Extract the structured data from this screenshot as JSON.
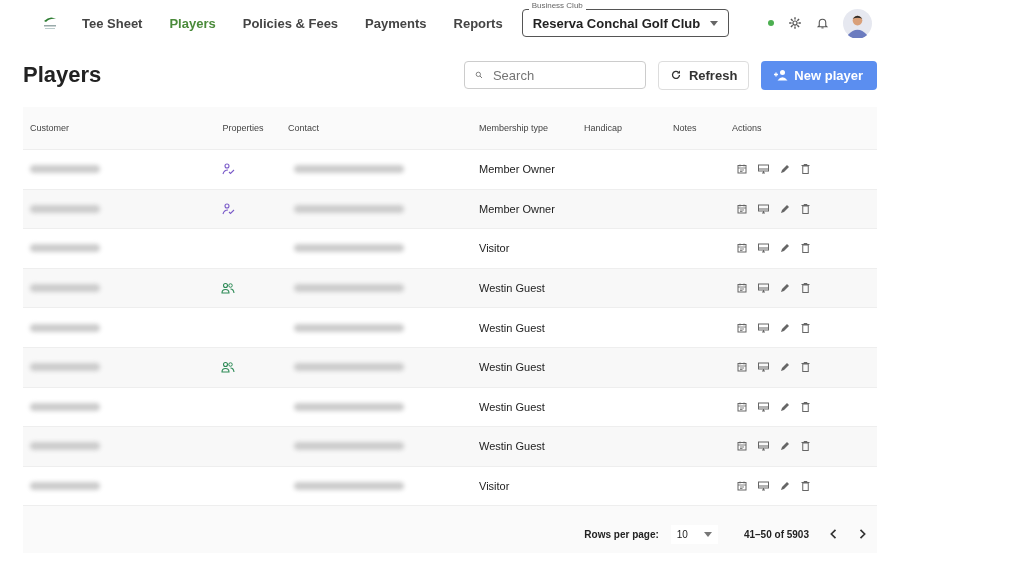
{
  "nav": {
    "items": [
      {
        "label": "Tee Sheet",
        "selected": false
      },
      {
        "label": "Players",
        "selected": true
      },
      {
        "label": "Policies & Fees",
        "selected": false
      },
      {
        "label": "Payments",
        "selected": false
      },
      {
        "label": "Reports",
        "selected": false
      }
    ],
    "club_select": {
      "label": "Business Club",
      "value": "Reserva Conchal Golf Club"
    },
    "online": true
  },
  "page": {
    "title": "Players",
    "search": {
      "placeholder": "Search"
    },
    "refresh": "Refresh",
    "new_player": "New player"
  },
  "table": {
    "columns": [
      "Customer",
      "Properties",
      "Contact",
      "Membership type",
      "Handicap",
      "Notes",
      "Actions"
    ],
    "rows": [
      {
        "kind": "owner",
        "membership": "Member Owner"
      },
      {
        "kind": "owner",
        "membership": "Member Owner"
      },
      {
        "kind": "plain",
        "membership": "Visitor"
      },
      {
        "kind": "guest",
        "membership": "Westin Guest"
      },
      {
        "kind": "plain",
        "membership": "Westin Guest"
      },
      {
        "kind": "guest",
        "membership": "Westin Guest"
      },
      {
        "kind": "plain",
        "membership": "Westin Guest"
      },
      {
        "kind": "plain",
        "membership": "Westin Guest"
      },
      {
        "kind": "plain",
        "membership": "Visitor"
      }
    ]
  },
  "pagination": {
    "rows_label": "Rows per page:",
    "rows_value": "10",
    "range": "41–50 of 5903"
  }
}
